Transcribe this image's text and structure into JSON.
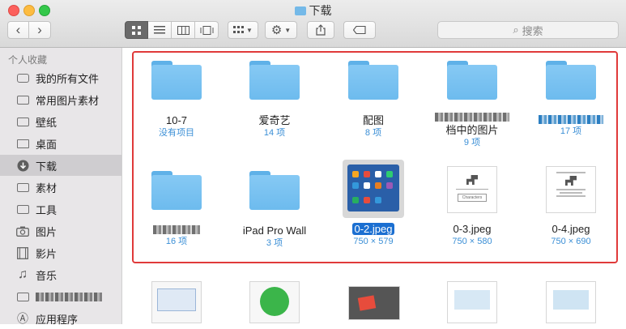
{
  "window": {
    "title": "下载"
  },
  "toolbar": {
    "back": "‹",
    "forward": "›",
    "search_placeholder": "搜索"
  },
  "sidebar": {
    "header": "个人收藏",
    "items": [
      {
        "label": "我的所有文件",
        "icon": "all-files-icon"
      },
      {
        "label": "常用图片素材",
        "icon": "folder-icon"
      },
      {
        "label": "壁纸",
        "icon": "folder-icon"
      },
      {
        "label": "桌面",
        "icon": "desktop-icon"
      },
      {
        "label": "下载",
        "icon": "download-icon",
        "selected": true
      },
      {
        "label": "素材",
        "icon": "folder-icon"
      },
      {
        "label": "工具",
        "icon": "folder-icon"
      },
      {
        "label": "图片",
        "icon": "camera-icon"
      },
      {
        "label": "影片",
        "icon": "film-icon"
      },
      {
        "label": "音乐",
        "icon": "music-icon"
      },
      {
        "label": "",
        "icon": "folder-icon"
      },
      {
        "label": "应用程序",
        "icon": "applications-icon"
      }
    ]
  },
  "files": [
    {
      "name": "10-7",
      "sub": "没有项目",
      "kind": "folder"
    },
    {
      "name": "爱奇艺",
      "sub": "14 项",
      "kind": "folder"
    },
    {
      "name": "配图",
      "sub": "8 项",
      "kind": "folder"
    },
    {
      "name": "档中的图片",
      "sub": "9 项",
      "kind": "folder"
    },
    {
      "name": "",
      "sub": "17 项",
      "kind": "folder"
    },
    {
      "name": "",
      "sub": "16 项",
      "kind": "folder"
    },
    {
      "name": "iPad Pro Wall",
      "sub": "3 项",
      "kind": "folder"
    },
    {
      "name": "0-2.jpeg",
      "sub": "750 × 579",
      "kind": "image",
      "selected": true
    },
    {
      "name": "0-3.jpeg",
      "sub": "750 × 580",
      "kind": "image"
    },
    {
      "name": "0-4.jpeg",
      "sub": "750 × 690",
      "kind": "image"
    }
  ],
  "thumb_text": {
    "characters": "Characters"
  },
  "colors": {
    "highlight_box": "#e03a3a",
    "selection": "#1b6fd1",
    "folder": "#6dbbee"
  }
}
